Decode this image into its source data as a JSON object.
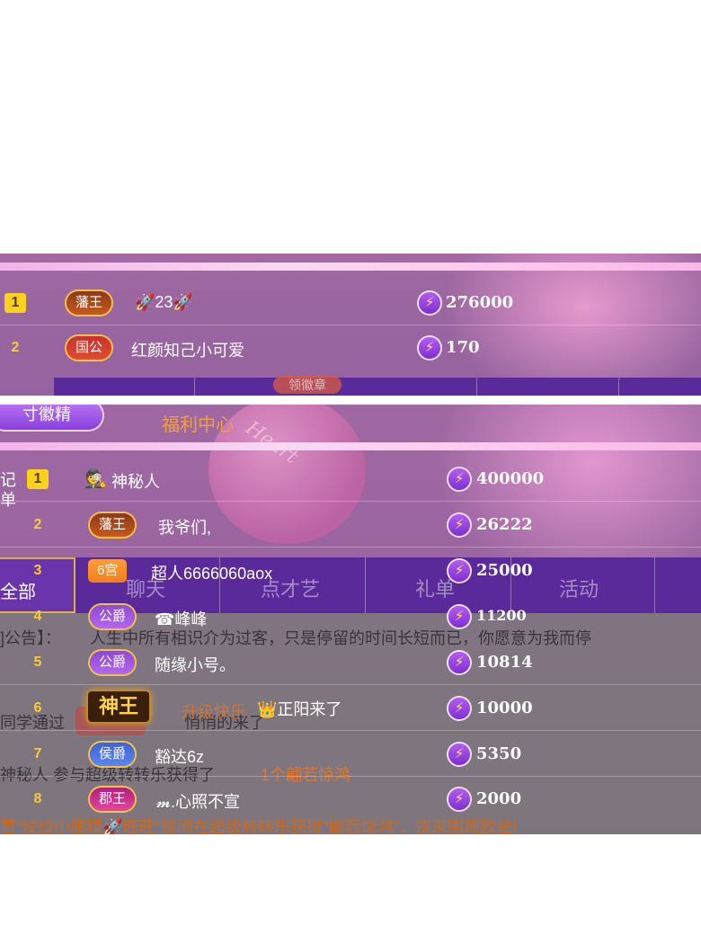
{
  "top": {
    "faded_button": "领徽章",
    "rows": [
      {
        "rank": "1",
        "rank_style": "gold",
        "badge": "藩王",
        "badge_style": "fanwang",
        "name": "🚀23🚀",
        "value": "276000"
      },
      {
        "rank": "2",
        "rank_style": "plain",
        "badge": "国公",
        "badge_style": "guogong",
        "name": "红颜知己小可爱",
        "value": "170"
      }
    ]
  },
  "bottom": {
    "collect_button": "寸徽精",
    "welfare_center": "福利中心",
    "balloon_text": "Heart",
    "side_labels": [
      "记",
      "单",
      "全部"
    ],
    "tabs": [
      "聊天",
      "点才艺",
      "礼单",
      "活动"
    ],
    "ghost_announcement_prefix": "]公告】：",
    "ghost_announcement": "人生中所有相识介为过客，只是停留的时间长短而已，你愿意为我而停",
    "ghost_line2a": "同学通过",
    "ghost_line2b": "悄悄的来了",
    "ghost_line3a": "神秘人 参与超级转转乐获得了",
    "ghost_line3b": "1个翩若惊鸿",
    "ghost_line4": "喜\"姣姣小腰精🚀旺旺\"房间在超级转转乐获得\"翩若惊鸿\"，快来围观欧皇!",
    "ghost_upgrade": "升级快乐",
    "rows": [
      {
        "rank": "1",
        "rank_style": "gold",
        "badge": "",
        "badge_style": "",
        "icon": "🕵",
        "name": "神秘人",
        "value": "400000"
      },
      {
        "rank": "2",
        "rank_style": "plain",
        "badge": "藩王",
        "badge_style": "fanwang",
        "name": "我爷们,",
        "value": "26222"
      },
      {
        "rank": "3",
        "rank_style": "plain",
        "badge": "6宫",
        "badge_style": "6gong",
        "name": "超人6666060aox",
        "value": "25000"
      },
      {
        "rank": "4",
        "rank_style": "plain",
        "badge": "公爵",
        "badge_style": "gongjue",
        "name": "☎峰峰",
        "value": "11200"
      },
      {
        "rank": "5",
        "rank_style": "plain",
        "badge": "公爵",
        "badge_style": "gongjue",
        "name": "随缘小号。",
        "value": "10814"
      },
      {
        "rank": "6",
        "rank_style": "plain",
        "badge": "神王",
        "badge_style": "shenwang",
        "name": "👑正阳来了",
        "value": "10000"
      },
      {
        "rank": "7",
        "rank_style": "plain",
        "badge": "侯爵",
        "badge_style": "houjue",
        "name": "豁达6z",
        "value": "5350"
      },
      {
        "rank": "8",
        "rank_style": "plain",
        "badge": "郡王",
        "badge_style": "junwang",
        "name": "𝓶.心照不宣",
        "value": "2000"
      }
    ]
  }
}
